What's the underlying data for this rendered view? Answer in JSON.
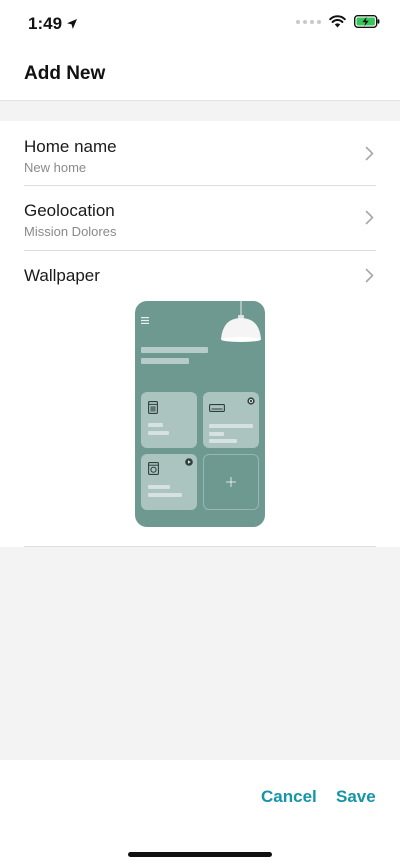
{
  "status": {
    "time": "1:49",
    "icons": [
      "location-arrow-icon",
      "cellular-signal-icon",
      "wifi-icon",
      "battery-charging-icon"
    ],
    "battery_color": "#35c759"
  },
  "header": {
    "title": "Add New"
  },
  "rows": [
    {
      "title": "Home name",
      "value": "New home",
      "icon": "chevron-right-icon"
    },
    {
      "title": "Geolocation",
      "value": "Mission Dolores",
      "icon": "chevron-right-icon"
    },
    {
      "title": "Wallpaper",
      "icon": "chevron-right-icon"
    }
  ],
  "wallpaper_preview": {
    "background_color": "#6e9991",
    "icons": [
      "menu-icon",
      "pendant-lamp-icon",
      "washer-icon",
      "air-conditioner-icon",
      "power-icon",
      "washing-machine-icon",
      "play-icon",
      "add-icon"
    ]
  },
  "footer": {
    "cancel_label": "Cancel",
    "save_label": "Save",
    "accent_color": "#1595a8"
  }
}
